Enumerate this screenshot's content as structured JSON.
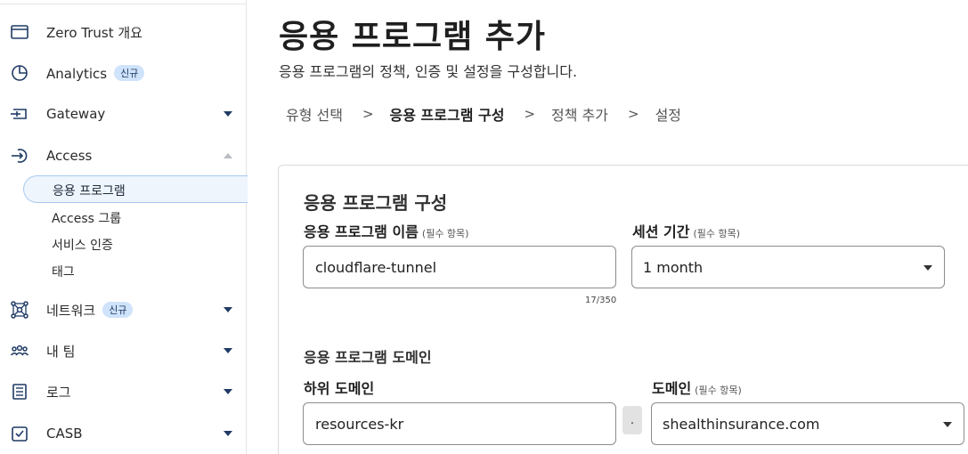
{
  "sidebar": {
    "items": [
      {
        "label": "Zero Trust 개요",
        "icon": "browser-window-icon"
      },
      {
        "label": "Analytics",
        "badge": "신규",
        "icon": "pie-chart-icon"
      },
      {
        "label": "Gateway",
        "icon": "gateway-icon"
      },
      {
        "label": "Access",
        "icon": "access-icon"
      },
      {
        "label": "네트워크",
        "badge": "신규",
        "icon": "network-icon"
      },
      {
        "label": "내 팀",
        "icon": "team-icon"
      },
      {
        "label": "로그",
        "icon": "logs-icon"
      },
      {
        "label": "CASB",
        "icon": "casb-icon"
      }
    ],
    "access_subitems": [
      {
        "label": "응용 프로그램"
      },
      {
        "label": "Access 그룹"
      },
      {
        "label": "서비스 인증"
      },
      {
        "label": "태그"
      }
    ]
  },
  "page": {
    "title": "응용 프로그램 추가",
    "subtitle": "응용 프로그램의 정책, 인증 및 설정을 구성합니다."
  },
  "breadcrumb": {
    "steps": [
      "유형 선택",
      "응용 프로그램 구성",
      "정책 추가",
      "설정"
    ],
    "separator": ">"
  },
  "form": {
    "card_title": "응용 프로그램 구성",
    "app_name": {
      "label": "응용 프로그램 이름",
      "required": "(필수 항목)",
      "value": "cloudflare-tunnel",
      "counter": "17/350"
    },
    "session": {
      "label": "세션 기간",
      "required": "(필수 항목)",
      "value": "1 month"
    },
    "domain_section": "응용 프로그램 도메인",
    "subdomain": {
      "label": "하위 도메인",
      "value": "resources-kr"
    },
    "dot": ".",
    "domain": {
      "label": "도메인",
      "required": "(필수 항목)",
      "value": "shealthinsurance.com"
    }
  },
  "colors": {
    "accent": "#1f3a64",
    "badge_bg": "#cfe3fb",
    "active_bg": "#eef5fd"
  }
}
